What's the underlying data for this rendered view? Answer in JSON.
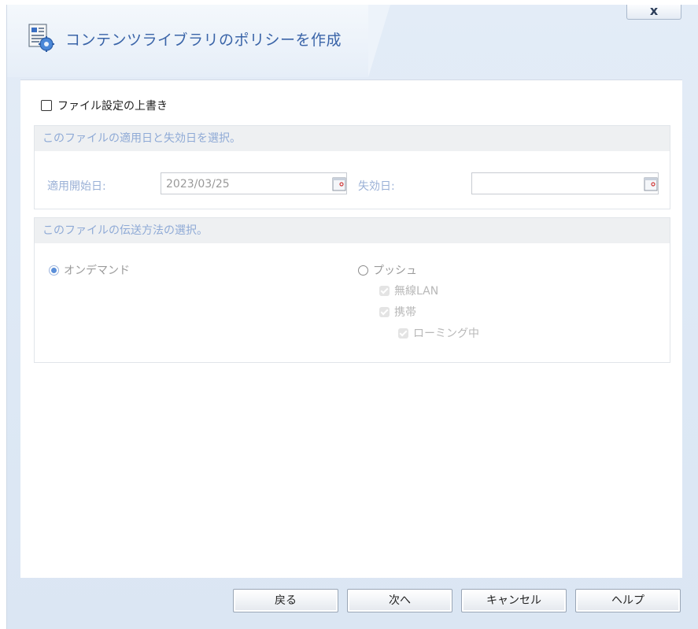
{
  "dialog": {
    "title": "コンテンツライブラリのポリシーを作成",
    "close_label": "x"
  },
  "override": {
    "label": "ファイル設定の上書き",
    "checked": false
  },
  "dates_section": {
    "header": "このファイルの適用日と失効日を選択。",
    "start_label": "適用開始日:",
    "start_value": "2023/03/25",
    "expire_label": "失効日:",
    "expire_value": ""
  },
  "delivery_section": {
    "header": "このファイルの伝送方法の選択。",
    "on_demand_label": "オンデマンド",
    "push_label": "プッシュ",
    "wifi_label": "無線LAN",
    "mobile_label": "携帯",
    "roaming_label": "ローミング中",
    "selected": "オンデマンド"
  },
  "footer": {
    "back_label": "戻る",
    "next_label": "次へ",
    "cancel_label": "キャンセル",
    "help_label": "ヘルプ"
  },
  "colors": {
    "title": "#3a64a8",
    "section_header_text": "#8faad6",
    "radio_selected": "#5b8fd9"
  }
}
